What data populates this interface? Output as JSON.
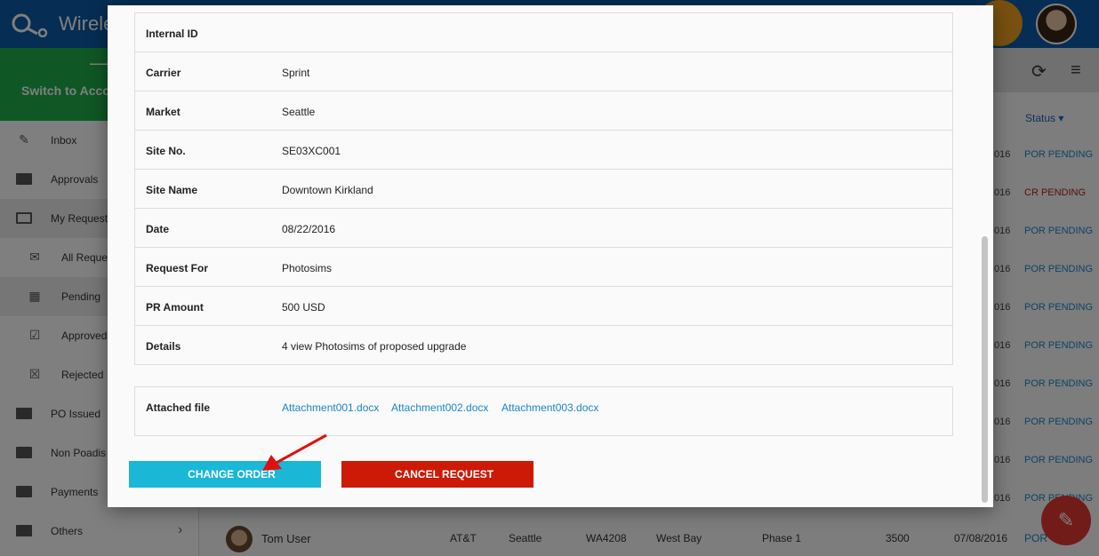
{
  "app": {
    "title": "Wirele"
  },
  "sidebar": {
    "switch_label": "Switch to Acco",
    "items": [
      {
        "label": "Inbox",
        "icon": "pencil-icon"
      },
      {
        "label": "Approvals",
        "icon": "folder-icon"
      },
      {
        "label": "My Requests",
        "icon": "folder-open-icon"
      },
      {
        "label": "All Reques",
        "icon": "mail-icon"
      },
      {
        "label": "Pending",
        "icon": "calendar-icon"
      },
      {
        "label": "Approved",
        "icon": "calendar-check-icon"
      },
      {
        "label": "Rejected",
        "icon": "calendar-x-icon"
      },
      {
        "label": "PO Issued",
        "icon": "folder-icon"
      },
      {
        "label": "Non Poadis",
        "icon": "folder-icon"
      },
      {
        "label": "Payments",
        "icon": "folder-icon"
      },
      {
        "label": "Others",
        "icon": "folder-icon"
      }
    ]
  },
  "list": {
    "status_header": "Status",
    "rows": [
      {
        "date": "016",
        "status": "POR PENDING",
        "status_color": "#1a86c8"
      },
      {
        "date": "016",
        "status": "CR PENDING",
        "status_color": "#b71c1c"
      },
      {
        "date": "016",
        "status": "POR PENDING",
        "status_color": "#1a86c8"
      },
      {
        "date": "016",
        "status": "POR PENDING",
        "status_color": "#1a86c8"
      },
      {
        "date": "016",
        "status": "POR PENDING",
        "status_color": "#1a86c8"
      },
      {
        "date": "016",
        "status": "POR PENDING",
        "status_color": "#1a86c8"
      },
      {
        "date": "016",
        "status": "POR PENDING",
        "status_color": "#1a86c8"
      },
      {
        "date": "016",
        "status": "POR PENDING",
        "status_color": "#1a86c8"
      },
      {
        "date": "016",
        "status": "POR PENDING",
        "status_color": "#1a86c8"
      },
      {
        "date": "016",
        "status": "POR PENDING",
        "status_color": "#1a86c8"
      }
    ],
    "bottom_row": {
      "name": "Tom User",
      "carrier": "AT&T",
      "market": "Seattle",
      "site": "WA4208",
      "site_name": "West Bay",
      "phase": "Phase 1",
      "amount": "3500",
      "date": "07/08/2016",
      "status": "POR"
    }
  },
  "modal": {
    "details": [
      {
        "key": "Internal ID",
        "value": ""
      },
      {
        "key": "Carrier",
        "value": "Sprint"
      },
      {
        "key": "Market",
        "value": "Seattle"
      },
      {
        "key": "Site No.",
        "value": "SE03XC001"
      },
      {
        "key": "Site Name",
        "value": "Downtown Kirkland"
      },
      {
        "key": "Date",
        "value": "08/22/2016"
      },
      {
        "key": "Request For",
        "value": "Photosims"
      },
      {
        "key": "PR Amount",
        "value": "500 USD"
      },
      {
        "key": "Details",
        "value": "4 view Photosims of proposed upgrade"
      }
    ],
    "attached_label": "Attached file",
    "attachments": [
      "Attachment001.docx",
      "Attachment002.docx",
      "Attachment003.docx"
    ],
    "change_order_label": "CHANGE ORDER",
    "cancel_request_label": "CANCEL REQUEST"
  },
  "colors": {
    "topbar": "#0d5aa7",
    "switch_bg": "#1fae4b",
    "change_btn": "#1ab7d6",
    "cancel_btn": "#cc1a07",
    "link": "#1a86c8"
  }
}
